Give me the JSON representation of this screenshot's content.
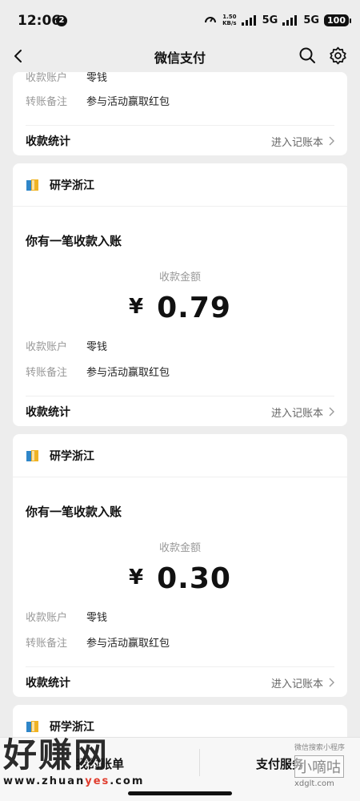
{
  "status": {
    "time": "12:06",
    "badge": "2",
    "speed": "1.50",
    "speed_unit": "KB/s",
    "net1": "5G",
    "net2": "5G",
    "battery": "100"
  },
  "nav": {
    "title": "微信支付"
  },
  "cards": [
    {
      "org": "",
      "heading": "",
      "amount_label": "",
      "currency": "",
      "amount": "",
      "account_key": "收款账户",
      "account_val": "零钱",
      "remark_key": "转账备注",
      "remark_val": "参与活动赢取红包",
      "stat_label": "收款统计",
      "link_label": "进入记账本"
    },
    {
      "org": "研学浙江",
      "heading": "你有一笔收款入账",
      "amount_label": "收款金额",
      "currency": "¥",
      "amount": "0.79",
      "account_key": "收款账户",
      "account_val": "零钱",
      "remark_key": "转账备注",
      "remark_val": "参与活动赢取红包",
      "stat_label": "收款统计",
      "link_label": "进入记账本"
    },
    {
      "org": "研学浙江",
      "heading": "你有一笔收款入账",
      "amount_label": "收款金额",
      "currency": "¥",
      "amount": "0.30",
      "account_key": "收款账户",
      "account_val": "零钱",
      "remark_key": "转账备注",
      "remark_val": "参与活动赢取红包",
      "stat_label": "收款统计",
      "link_label": "进入记账本"
    },
    {
      "org": "研学浙江"
    }
  ],
  "bottom": {
    "left_label": "我的账单",
    "right_label": "支付服务"
  },
  "watermarks": {
    "left_big": "好赚网",
    "left_url_a": "www.zhuan",
    "left_url_b": "yes",
    "left_url_c": ".com",
    "right_small": "微信搜索小程序",
    "right_name": "小嘀咕",
    "right_domain": "xdglt.com"
  },
  "colors": {
    "background": "#ededed",
    "card": "#ffffff",
    "muted": "#999999",
    "watermark_accent": "#e03c2d"
  }
}
